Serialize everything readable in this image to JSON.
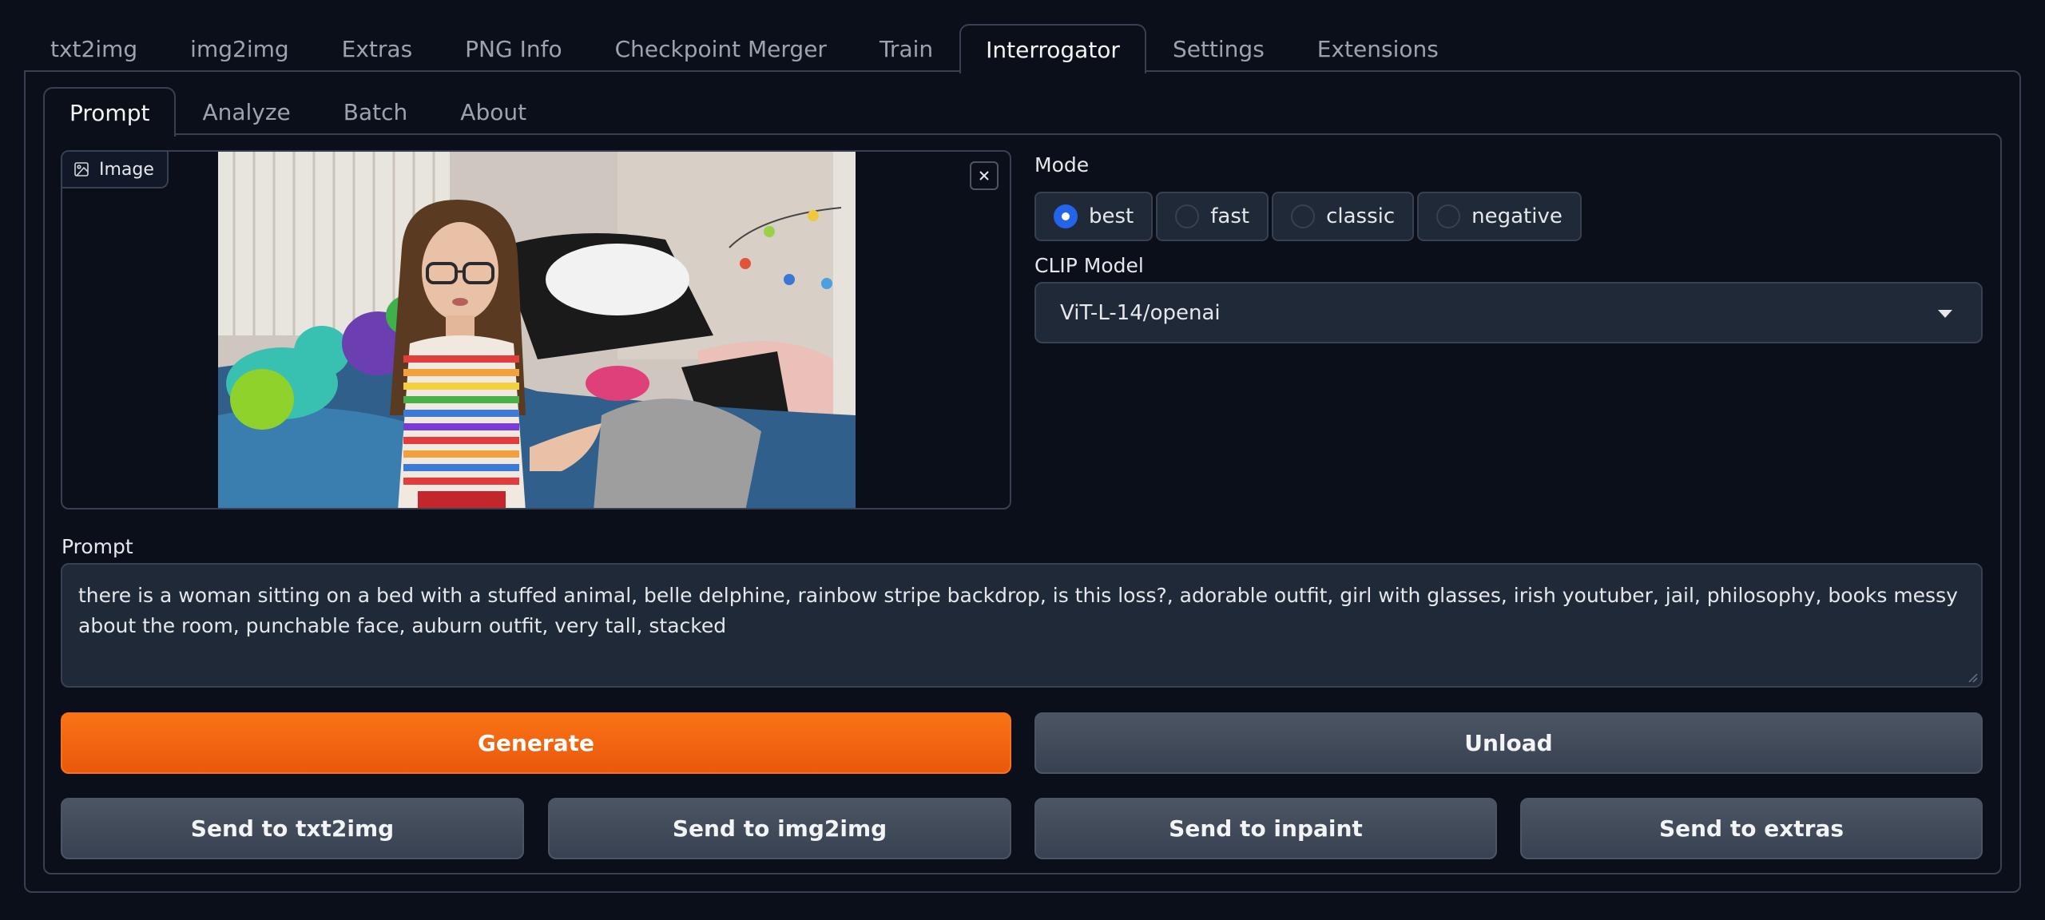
{
  "top_tabs": [
    {
      "label": "txt2img",
      "active": false
    },
    {
      "label": "img2img",
      "active": false
    },
    {
      "label": "Extras",
      "active": false
    },
    {
      "label": "PNG Info",
      "active": false
    },
    {
      "label": "Checkpoint Merger",
      "active": false
    },
    {
      "label": "Train",
      "active": false
    },
    {
      "label": "Interrogator",
      "active": true
    },
    {
      "label": "Settings",
      "active": false
    },
    {
      "label": "Extensions",
      "active": false
    }
  ],
  "inner_tabs": [
    {
      "label": "Prompt",
      "active": true
    },
    {
      "label": "Analyze",
      "active": false
    },
    {
      "label": "Batch",
      "active": false
    },
    {
      "label": "About",
      "active": false
    }
  ],
  "image_panel": {
    "label": "Image",
    "label_icon": "image-icon",
    "close_icon": "close-icon"
  },
  "mode": {
    "label": "Mode",
    "options": [
      "best",
      "fast",
      "classic",
      "negative"
    ],
    "selected": "best"
  },
  "clip_model": {
    "label": "CLIP Model",
    "value": "ViT-L-14/openai",
    "icon": "chevron-down-icon"
  },
  "prompt": {
    "label": "Prompt",
    "value": "there is a woman sitting on a bed with a stuffed animal, belle delphine, rainbow stripe backdrop, is this loss?, adorable outfit, girl with glasses, irish youtuber, jail, philosophy, books messy about the room, punchable face, auburn outfit, very tall, stacked"
  },
  "buttons": {
    "generate": "Generate",
    "unload": "Unload",
    "send_txt2img": "Send to txt2img",
    "send_img2img": "Send to img2img",
    "send_inpaint": "Send to inpaint",
    "send_extras": "Send to extras"
  },
  "colors": {
    "background": "#0b0f19",
    "panel": "#1f2937",
    "border": "#374151",
    "primary": "#f97316",
    "radio_selected": "#2563eb"
  }
}
